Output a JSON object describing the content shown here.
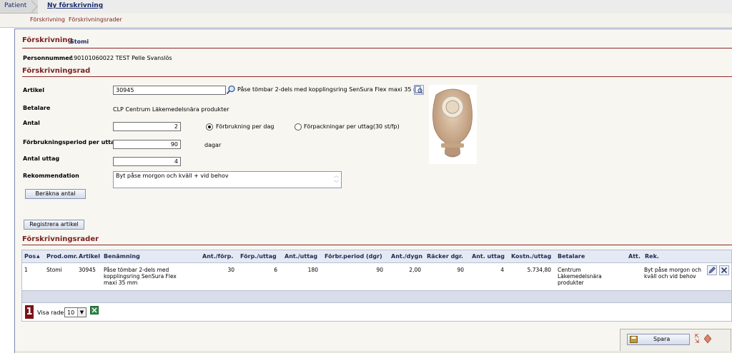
{
  "breadcrumb": {
    "patient": "Patient",
    "new_prescription": "Ny förskrivning"
  },
  "subtabs": [
    "Förskrivning",
    "Förskrivningsrader"
  ],
  "prescription": {
    "title": "Förskrivning",
    "type": "Stomi",
    "personnummer_label": "Personnummer",
    "personnummer_value": "190101060022 TEST Pelle Svanslös"
  },
  "row_section": {
    "title": "Förskrivningsrad",
    "artikel_label": "Artikel",
    "artikel_value": "30945",
    "artikel_name": "Påse tömbar 2-dels med kopplingsring SenSura Flex maxi 35 mm",
    "betalare_label": "Betalare",
    "betalare_value": "CLP Centrum Läkemedelsnära produkter",
    "antal_label": "Antal",
    "antal_value": "2",
    "radio_per_dag": "Förbrukning per dag",
    "radio_per_uttag": "Förpackningar per uttag(30 st/fp)",
    "period_label": "Förbrukningsperiod per uttag",
    "period_value": "90",
    "period_unit": "dagar",
    "uttag_label": "Antal uttag",
    "uttag_value": "4",
    "rek_label": "Rekommendation",
    "rek_value": "Byt påse morgon och kväll + vid behov",
    "calc_button": "Beräkna antal",
    "register_button": "Registrera artikel"
  },
  "rows_section": {
    "title": "Förskrivningsrader",
    "columns": [
      "Pos",
      "Prod.omr.",
      "Artikel",
      "Benämning",
      "Ant./förp.",
      "Förp./uttag",
      "Ant./uttag",
      "Förbr.period (dgr)",
      "Ant./dygn",
      "Räcker dgr.",
      "Ant. uttag",
      "Kostn./uttag",
      "Betalare",
      "Att.",
      "Rek."
    ],
    "rows": [
      {
        "pos": "1",
        "prod": "Stomi",
        "artikel": "30945",
        "benamning": "Påse tömbar 2-dels med kopplingsring SenSura Flex maxi 35 mm",
        "ant_forp": "30",
        "forp_uttag": "6",
        "ant_uttag": "180",
        "period": "90",
        "ant_dygn": "2,00",
        "racker": "90",
        "antal_uttag": "4",
        "kostn": "5.734,80",
        "betalare": "Centrum Läkemedelsnära produkter",
        "att": "",
        "rek": "Byt påse morgon och kväll och vid behov"
      }
    ]
  },
  "pager": {
    "page": "1",
    "visa_rader_label": "Visa rader",
    "rows_per_page": "10"
  },
  "save": {
    "label": "Spara"
  }
}
